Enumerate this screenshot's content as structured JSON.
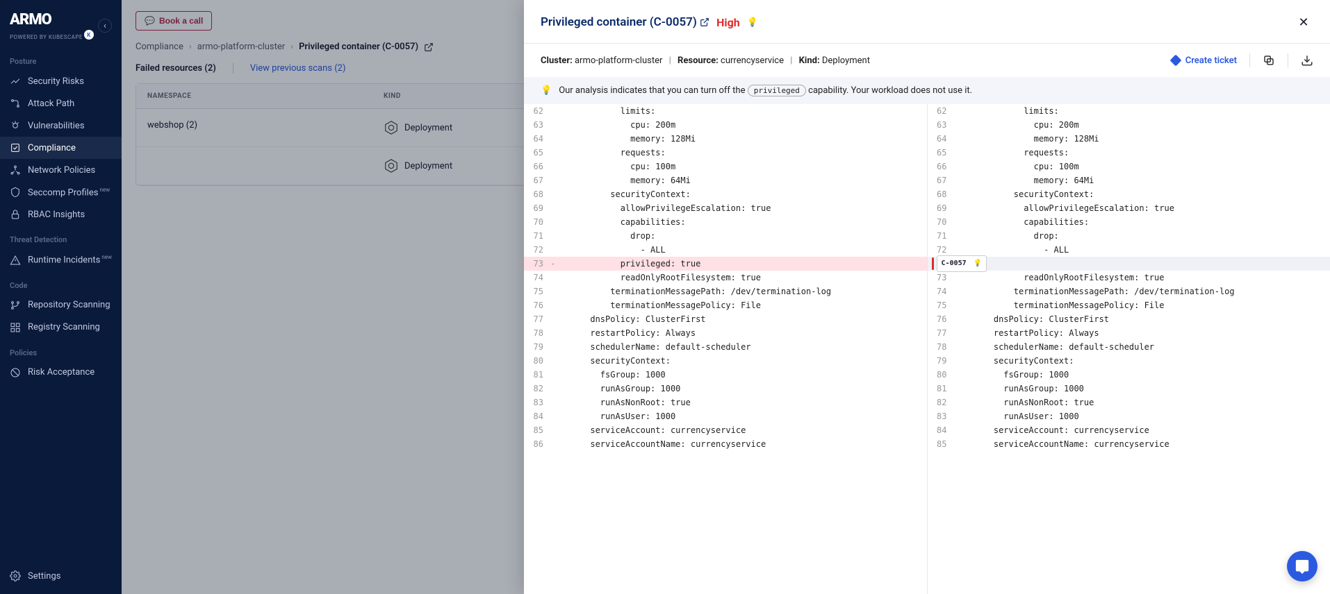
{
  "brand": {
    "name": "ARMO",
    "tagline": "POWERED BY KUBESCAPE"
  },
  "topbar": {
    "book_call": "Book a call"
  },
  "breadcrumb": {
    "a": "Compliance",
    "b": "armo-platform-cluster",
    "c": "Privileged container (C-0057)"
  },
  "subtabs": {
    "failed": "Failed resources (2)",
    "previous": "View previous scans (2)"
  },
  "table": {
    "headers": {
      "namespace": "NAMESPACE",
      "kind": "KIND"
    },
    "rows": [
      {
        "namespace": "webshop (2)",
        "kind": "Deployment"
      },
      {
        "namespace": "",
        "kind": "Deployment"
      }
    ]
  },
  "sidebar": {
    "sections": [
      {
        "label": "Posture",
        "items": [
          {
            "label": "Security Risks",
            "icon": "trend"
          },
          {
            "label": "Attack Path",
            "icon": "path"
          },
          {
            "label": "Vulnerabilities",
            "icon": "bug"
          },
          {
            "label": "Compliance",
            "icon": "check",
            "active": true
          },
          {
            "label": "Network Policies",
            "icon": "network"
          },
          {
            "label": "Seccomp Profiles",
            "icon": "shield",
            "badge": "new"
          },
          {
            "label": "RBAC Insights",
            "icon": "lock"
          }
        ]
      },
      {
        "label": "Threat Detection",
        "items": [
          {
            "label": "Runtime Incidents",
            "icon": "alert",
            "badge": "new"
          }
        ]
      },
      {
        "label": "Code",
        "items": [
          {
            "label": "Repository Scanning",
            "icon": "branch"
          },
          {
            "label": "Registry Scanning",
            "icon": "registry"
          }
        ]
      },
      {
        "label": "Policies",
        "items": [
          {
            "label": "Risk Acceptance",
            "icon": "eye-off"
          }
        ]
      }
    ],
    "footer": {
      "settings": "Settings"
    }
  },
  "drawer": {
    "title": "Privileged container (C-0057)",
    "severity": "High",
    "meta": {
      "cluster_label": "Cluster:",
      "cluster": "armo-platform-cluster",
      "resource_label": "Resource:",
      "resource": "currencyservice",
      "kind_label": "Kind:",
      "kind": "Deployment"
    },
    "actions": {
      "create_ticket": "Create ticket"
    },
    "hint_pre": "Our analysis indicates that you can turn off the ",
    "hint_cap": "privileged",
    "hint_post": " capability. Your workload does not use it.",
    "badge": "C-0057",
    "diff_left": [
      {
        "n": 62,
        "t": "            limits:"
      },
      {
        "n": 63,
        "t": "              cpu: 200m"
      },
      {
        "n": 64,
        "t": "              memory: 128Mi"
      },
      {
        "n": 65,
        "t": "            requests:"
      },
      {
        "n": 66,
        "t": "              cpu: 100m"
      },
      {
        "n": 67,
        "t": "              memory: 64Mi"
      },
      {
        "n": 68,
        "t": "          securityContext:"
      },
      {
        "n": 69,
        "t": "            allowPrivilegeEscalation: true"
      },
      {
        "n": 70,
        "t": "            capabilities:"
      },
      {
        "n": 71,
        "t": "              drop:"
      },
      {
        "n": 72,
        "t": "                - ALL"
      },
      {
        "n": 73,
        "t": "            privileged: true",
        "removed": true
      },
      {
        "n": 74,
        "t": "            readOnlyRootFilesystem: true"
      },
      {
        "n": 75,
        "t": "          terminationMessagePath: /dev/termination-log"
      },
      {
        "n": 76,
        "t": "          terminationMessagePolicy: File"
      },
      {
        "n": 77,
        "t": "      dnsPolicy: ClusterFirst"
      },
      {
        "n": 78,
        "t": "      restartPolicy: Always"
      },
      {
        "n": 79,
        "t": "      schedulerName: default-scheduler"
      },
      {
        "n": 80,
        "t": "      securityContext:"
      },
      {
        "n": 81,
        "t": "        fsGroup: 1000"
      },
      {
        "n": 82,
        "t": "        runAsGroup: 1000"
      },
      {
        "n": 83,
        "t": "        runAsNonRoot: true"
      },
      {
        "n": 84,
        "t": "        runAsUser: 1000"
      },
      {
        "n": 85,
        "t": "      serviceAccount: currencyservice"
      },
      {
        "n": 86,
        "t": "      serviceAccountName: currencyservice"
      }
    ],
    "diff_right": [
      {
        "n": 62,
        "t": "            limits:"
      },
      {
        "n": 63,
        "t": "              cpu: 200m"
      },
      {
        "n": 64,
        "t": "              memory: 128Mi"
      },
      {
        "n": 65,
        "t": "            requests:"
      },
      {
        "n": 66,
        "t": "              cpu: 100m"
      },
      {
        "n": 67,
        "t": "              memory: 64Mi"
      },
      {
        "n": 68,
        "t": "          securityContext:"
      },
      {
        "n": 69,
        "t": "            allowPrivilegeEscalation: true"
      },
      {
        "n": 70,
        "t": "            capabilities:"
      },
      {
        "n": 71,
        "t": "              drop:"
      },
      {
        "n": 72,
        "t": "                - ALL"
      },
      {
        "badge": true
      },
      {
        "n": 73,
        "t": "            readOnlyRootFilesystem: true"
      },
      {
        "n": 74,
        "t": "          terminationMessagePath: /dev/termination-log"
      },
      {
        "n": 75,
        "t": "          terminationMessagePolicy: File"
      },
      {
        "n": 76,
        "t": "      dnsPolicy: ClusterFirst"
      },
      {
        "n": 77,
        "t": "      restartPolicy: Always"
      },
      {
        "n": 78,
        "t": "      schedulerName: default-scheduler"
      },
      {
        "n": 79,
        "t": "      securityContext:"
      },
      {
        "n": 80,
        "t": "        fsGroup: 1000"
      },
      {
        "n": 81,
        "t": "        runAsGroup: 1000"
      },
      {
        "n": 82,
        "t": "        runAsNonRoot: true"
      },
      {
        "n": 83,
        "t": "        runAsUser: 1000"
      },
      {
        "n": 84,
        "t": "      serviceAccount: currencyservice"
      },
      {
        "n": 85,
        "t": "      serviceAccountName: currencyservice"
      }
    ]
  }
}
